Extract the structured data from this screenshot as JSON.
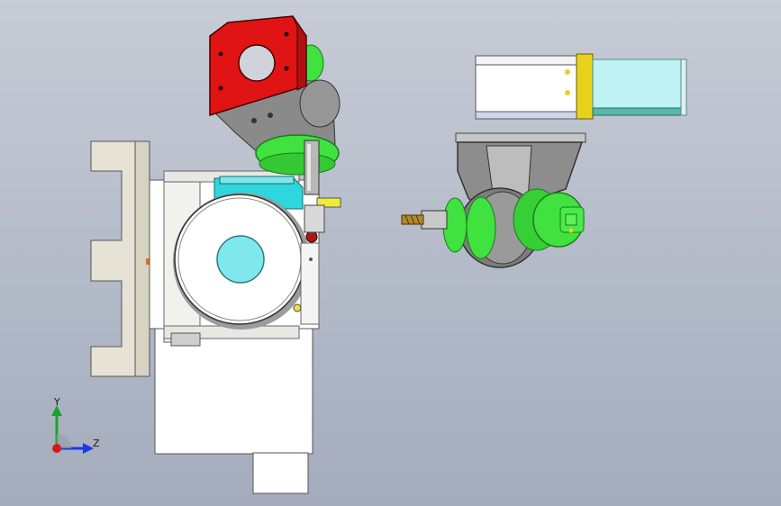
{
  "viewport": {
    "background_top": "#c7ccd6",
    "background_bottom": "#a4acbd"
  },
  "triad": {
    "y_label": "Y",
    "z_label": "Z",
    "y_color": "#1aa32a",
    "z_color": "#1a3be0",
    "origin_color": "#d81818"
  },
  "colors": {
    "red_block": "#e01414",
    "green_part": "#3fe23f",
    "cyan_part": "#2ed6de",
    "yellow_band": "#e6d21c",
    "light_cyan": "#bff2f2",
    "frame_grey": "#9a9a9a",
    "light_frame": "#ecebe4"
  }
}
